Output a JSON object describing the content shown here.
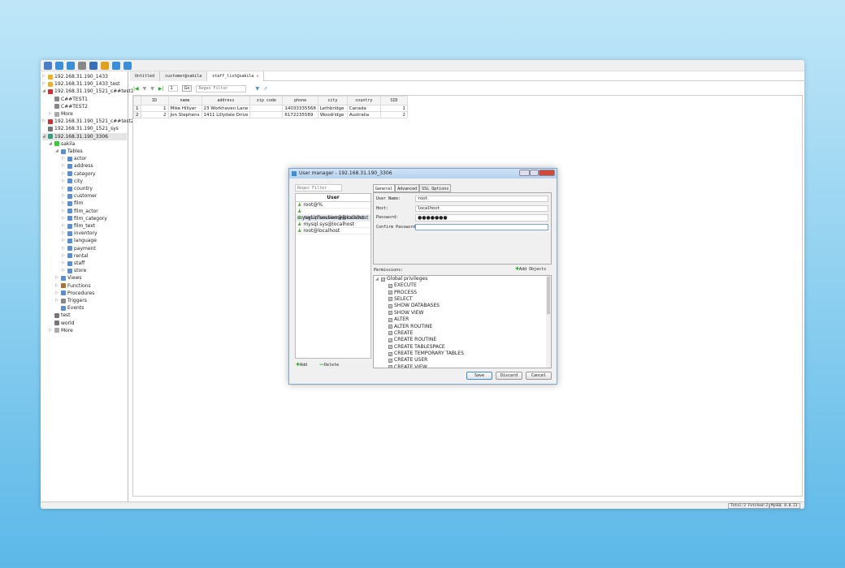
{
  "toolbar": {
    "icons": [
      "connection-icon",
      "new-query-icon",
      "open-icon",
      "save-icon",
      "binoculars-icon",
      "user-icon",
      "tools-icon",
      "schedule-icon"
    ]
  },
  "sidebar": {
    "items": [
      {
        "label": "192.168.31.190_1433",
        "level": 0,
        "icon": "sqlserver-icon",
        "color": "#f0b020",
        "arrow": "▷"
      },
      {
        "label": "192.168.31.190_1433_test",
        "level": 0,
        "icon": "sqlserver-icon",
        "color": "#f0b020",
        "arrow": "▷"
      },
      {
        "label": "192.168.31.190_1521_c##test1",
        "level": 0,
        "icon": "oracle-icon",
        "color": "#d03030",
        "arrow": "◢"
      },
      {
        "label": "C##TEST1",
        "level": 1,
        "icon": "schema-icon",
        "color": "#888",
        "arrow": ""
      },
      {
        "label": "C##TEST2",
        "level": 1,
        "icon": "schema-icon",
        "color": "#888",
        "arrow": ""
      },
      {
        "label": "More",
        "level": 1,
        "icon": "more-icon",
        "color": "#aaa",
        "arrow": "▷"
      },
      {
        "label": "192.168.31.190_1521_c##test2",
        "level": 0,
        "icon": "oracle-icon",
        "color": "#d03030",
        "arrow": "▷"
      },
      {
        "label": "192.168.31.190_1521_sys",
        "level": 0,
        "icon": "database-icon",
        "color": "#777",
        "arrow": ""
      },
      {
        "label": "192.168.31.190_3306",
        "level": 0,
        "icon": "mysql-icon",
        "color": "#30a080",
        "arrow": "◢",
        "selected": true
      },
      {
        "label": "sakila",
        "level": 1,
        "icon": "database-icon",
        "color": "#3c3",
        "arrow": "◢"
      },
      {
        "label": "Tables",
        "level": 2,
        "icon": "tables-icon",
        "color": "#5a8fd8",
        "arrow": "◢"
      },
      {
        "label": "actor",
        "level": 3,
        "icon": "table-icon",
        "color": "#5a8fd8",
        "arrow": "▷"
      },
      {
        "label": "address",
        "level": 3,
        "icon": "table-icon",
        "color": "#5a8fd8",
        "arrow": "▷"
      },
      {
        "label": "category",
        "level": 3,
        "icon": "table-icon",
        "color": "#5a8fd8",
        "arrow": "▷"
      },
      {
        "label": "city",
        "level": 3,
        "icon": "table-icon",
        "color": "#5a8fd8",
        "arrow": "▷"
      },
      {
        "label": "country",
        "level": 3,
        "icon": "table-icon",
        "color": "#5a8fd8",
        "arrow": "▷"
      },
      {
        "label": "customer",
        "level": 3,
        "icon": "table-icon",
        "color": "#5a8fd8",
        "arrow": "▷"
      },
      {
        "label": "film",
        "level": 3,
        "icon": "table-icon",
        "color": "#5a8fd8",
        "arrow": "▷"
      },
      {
        "label": "film_actor",
        "level": 3,
        "icon": "table-icon",
        "color": "#5a8fd8",
        "arrow": "▷"
      },
      {
        "label": "film_category",
        "level": 3,
        "icon": "table-icon",
        "color": "#5a8fd8",
        "arrow": "▷"
      },
      {
        "label": "film_text",
        "level": 3,
        "icon": "table-icon",
        "color": "#5a8fd8",
        "arrow": "▷"
      },
      {
        "label": "inventory",
        "level": 3,
        "icon": "table-icon",
        "color": "#5a8fd8",
        "arrow": "▷"
      },
      {
        "label": "language",
        "level": 3,
        "icon": "table-icon",
        "color": "#5a8fd8",
        "arrow": "▷"
      },
      {
        "label": "payment",
        "level": 3,
        "icon": "table-icon",
        "color": "#5a8fd8",
        "arrow": "▷"
      },
      {
        "label": "rental",
        "level": 3,
        "icon": "table-icon",
        "color": "#5a8fd8",
        "arrow": "▷"
      },
      {
        "label": "staff",
        "level": 3,
        "icon": "table-icon",
        "color": "#5a8fd8",
        "arrow": "▷"
      },
      {
        "label": "store",
        "level": 3,
        "icon": "table-icon",
        "color": "#5a8fd8",
        "arrow": "▷"
      },
      {
        "label": "Views",
        "level": 2,
        "icon": "views-icon",
        "color": "#5a8fd8",
        "arrow": "▷"
      },
      {
        "label": "Functions",
        "level": 2,
        "icon": "function-icon",
        "color": "#b07030",
        "arrow": "▷"
      },
      {
        "label": "Procedures",
        "level": 2,
        "icon": "procedure-icon",
        "color": "#5a8fd8",
        "arrow": "▷"
      },
      {
        "label": "Triggers",
        "level": 2,
        "icon": "trigger-icon",
        "color": "#888",
        "arrow": "▷"
      },
      {
        "label": "Events",
        "level": 2,
        "icon": "events-icon",
        "color": "#5a8fd8",
        "arrow": ""
      },
      {
        "label": "test",
        "level": 1,
        "icon": "database-icon",
        "color": "#777",
        "arrow": ""
      },
      {
        "label": "world",
        "level": 1,
        "icon": "database-icon",
        "color": "#777",
        "arrow": ""
      },
      {
        "label": "More",
        "level": 1,
        "icon": "more-icon",
        "color": "#aaa",
        "arrow": "▷"
      }
    ]
  },
  "tabs": [
    {
      "label": "Untitled",
      "active": false
    },
    {
      "label": "customer@sakila",
      "active": false
    },
    {
      "label": "staff_list@sakila",
      "active": true
    }
  ],
  "grid_toolbar": {
    "page": "1",
    "go": "Go",
    "filter_placeholder": "Regex Filter"
  },
  "table": {
    "columns": [
      "ID",
      "name",
      "address",
      "zip code",
      "phone",
      "city",
      "country",
      "SID"
    ],
    "rows": [
      [
        "1",
        "1",
        "Mike Hillyer",
        "23 Workhaven Lane",
        "",
        "14033335568",
        "Lethbridge",
        "Canada",
        "1"
      ],
      [
        "2",
        "2",
        "Jon Stephens",
        "1411 Lillydale Drive",
        "",
        "6172235589",
        "Woodridge",
        "Australia",
        "2"
      ]
    ]
  },
  "status": {
    "total": "Total:2 Fetched:2",
    "version": "MySQL 8.0.21"
  },
  "dialog": {
    "title": "User manager - 192.168.31.190_3306",
    "filter_placeholder": "Regex Filter",
    "user_header": "User",
    "users": [
      "root@%",
      "mysql.infoschema@localhost",
      "mysql.session@localhost",
      "mysql.sys@localhost",
      "root@localhost"
    ],
    "selected_user": "mysql.session@localhost",
    "tabs": [
      "General",
      "Advanced",
      "SSL Options"
    ],
    "fields": {
      "user_name_label": "User Name:",
      "user_name": "root",
      "host_label": "Host:",
      "host": "localhost",
      "password_label": "Password:",
      "password": "●●●●●●●",
      "confirm_label": "Confirm Password:",
      "confirm": ""
    },
    "permissions_label": "Permissions:",
    "add_objects": "Add Objects",
    "global_privileges": "Global privileges",
    "privileges": [
      "EXECUTE",
      "PROCESS",
      "SELECT",
      "SHOW DATABASES",
      "SHOW VIEW",
      "ALTER",
      "ALTER ROUTINE",
      "CREATE",
      "CREATE ROUTINE",
      "CREATE TABLESPACE",
      "CREATE TEMPORARY TABLES",
      "CREATE USER",
      "CREATE VIEW"
    ],
    "add": "Add",
    "delete": "Delete",
    "save": "Save",
    "discard": "Discard",
    "cancel": "Cancel"
  }
}
